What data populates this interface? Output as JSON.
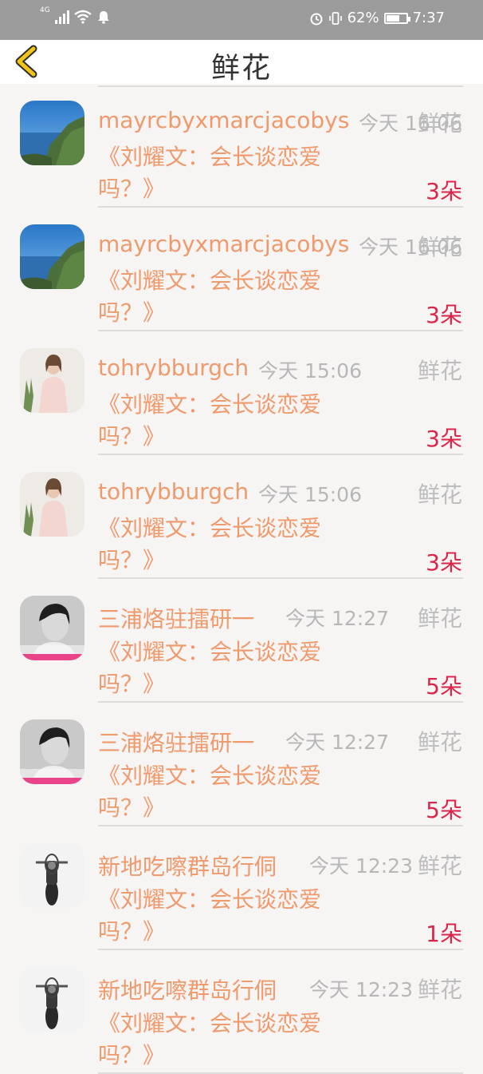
{
  "statusbar": {
    "network": "4G",
    "battery": "62%",
    "time": "7:37"
  },
  "header": {
    "title": "鲜花",
    "back_icon": "chevron-left-icon",
    "back_color": "#f2c318"
  },
  "colors": {
    "name": "#ef9a6c",
    "count": "#d9264a",
    "muted": "#b7b7b7"
  },
  "items": [
    {
      "name": "mayrcbyxmarcjacobys",
      "time": "今天 16:06",
      "type": "鲜花",
      "message": "《刘耀文：会长谈恋爱吗？》",
      "count": "3朵",
      "avatar": "landscape"
    },
    {
      "name": "mayrcbyxmarcjacobys",
      "time": "今天 16:06",
      "type": "鲜花",
      "message": "《刘耀文：会长谈恋爱吗？》",
      "count": "3朵",
      "avatar": "landscape"
    },
    {
      "name": "tohrybburgch",
      "time": "今天 15:06",
      "type": "鲜花",
      "message": "《刘耀文：会长谈恋爱吗？》",
      "count": "3朵",
      "avatar": "woman"
    },
    {
      "name": "tohrybburgch",
      "time": "今天 15:06",
      "type": "鲜花",
      "message": "《刘耀文：会长谈恋爱吗？》",
      "count": "3朵",
      "avatar": "woman"
    },
    {
      "name": "三浦烙驻擂研一",
      "time": "今天 12:27",
      "type": "鲜花",
      "message": "《刘耀文：会长谈恋爱吗？》",
      "count": "5朵",
      "avatar": "person-bw"
    },
    {
      "name": "三浦烙驻擂研一",
      "time": "今天 12:27",
      "type": "鲜花",
      "message": "《刘耀文：会长谈恋爱吗？》",
      "count": "5朵",
      "avatar": "person-bw"
    },
    {
      "name": "新地吃嚓群岛行侗",
      "time": "今天 12:23",
      "type": "鲜花",
      "message": "《刘耀文：会长谈恋爱吗？》",
      "count": "1朵",
      "avatar": "motorcycle"
    },
    {
      "name": "新地吃嚓群岛行侗",
      "time": "今天 12:23",
      "type": "鲜花",
      "message": "《刘耀文：会长谈恋爱吗？》",
      "count": "",
      "avatar": "motorcycle"
    }
  ]
}
